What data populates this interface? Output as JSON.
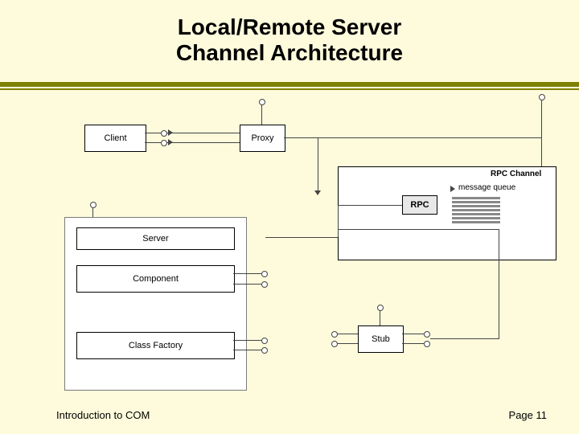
{
  "title_line1": "Local/Remote Server",
  "title_line2": "Channel Architecture",
  "footer": {
    "left": "Introduction to COM",
    "right": "Page 11"
  },
  "boxes": {
    "client": "Client",
    "proxy": "Proxy",
    "server": "Server",
    "component": "Component",
    "class_factory": "Class Factory",
    "stub": "Stub",
    "rpc": "RPC"
  },
  "labels": {
    "rpc_channel": "RPC Channel",
    "message_queue": "message queue"
  }
}
